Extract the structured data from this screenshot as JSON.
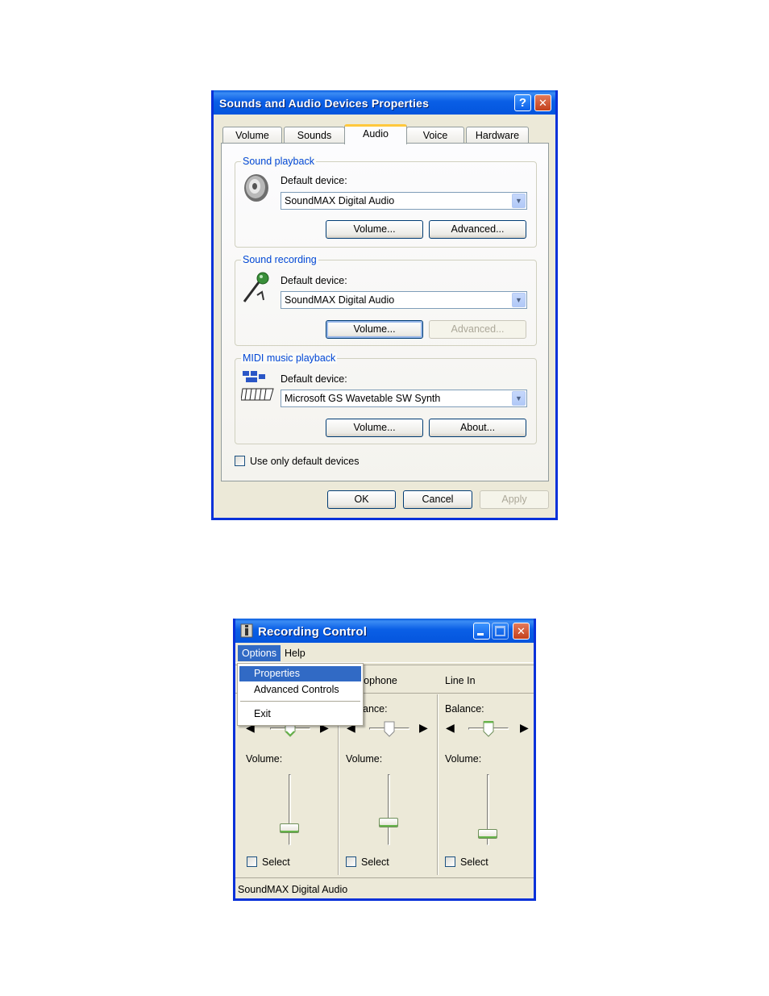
{
  "props_dialog": {
    "title": "Sounds and Audio Devices Properties",
    "help_btn": "?",
    "close_btn": "✕",
    "tabs": [
      "Volume",
      "Sounds",
      "Audio",
      "Voice",
      "Hardware"
    ],
    "active_tab": "Audio",
    "playback": {
      "legend": "Sound playback",
      "device_label": "Default device:",
      "device_value": "SoundMAX Digital Audio",
      "volume_btn": "Volume...",
      "advanced_btn": "Advanced..."
    },
    "recording": {
      "legend": "Sound recording",
      "device_label": "Default device:",
      "device_value": "SoundMAX Digital Audio",
      "volume_btn": "Volume...",
      "advanced_btn": "Advanced..."
    },
    "midi": {
      "legend": "MIDI music playback",
      "device_label": "Default device:",
      "device_value": "Microsoft GS Wavetable SW Synth",
      "volume_btn": "Volume...",
      "about_btn": "About..."
    },
    "use_default_label": "Use only default devices",
    "ok": "OK",
    "cancel": "Cancel",
    "apply": "Apply"
  },
  "recording_control": {
    "title": "Recording Control",
    "menu": [
      "Options",
      "Help"
    ],
    "options_menu": [
      "Properties",
      "Advanced Controls",
      "Exit"
    ],
    "highlighted_item": "Properties",
    "columns": [
      {
        "name": "",
        "balance_label": "",
        "volume_label": "Volume:",
        "select_label": "Select"
      },
      {
        "name": "rophone",
        "balance_label": "ance:",
        "volume_label": "Volume:",
        "select_label": "Select"
      },
      {
        "name": "Line In",
        "balance_label": "Balance:",
        "volume_label": "Volume:",
        "select_label": "Select"
      }
    ],
    "status": "SoundMAX Digital Audio"
  },
  "colors": {
    "title_blue": "#0a5de0",
    "legend_blue": "#0046d5",
    "menu_highlight": "#316ac5",
    "xp_face": "#ece9d8"
  }
}
